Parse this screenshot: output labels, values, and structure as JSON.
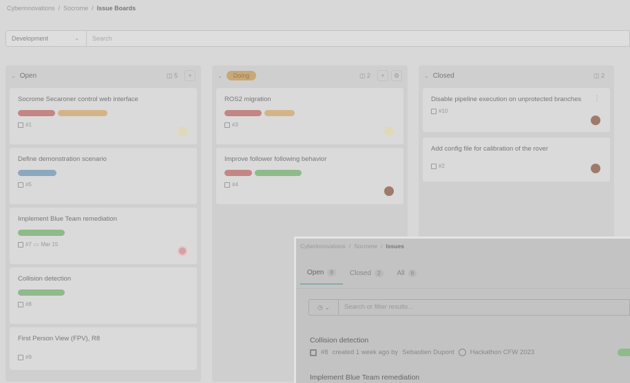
{
  "breadcrumb": [
    "Cyberinnovations",
    "Socrome",
    "Issue Boards"
  ],
  "board": {
    "selector": "Development",
    "search_placeholder": "Search"
  },
  "columns": {
    "open": {
      "title": "Open",
      "count": "5",
      "cards": [
        {
          "title": "Socrome Secaroner control web interface",
          "number": "#1",
          "labels": [
            "red",
            "orange"
          ]
        },
        {
          "title": "Define demonstration scenario",
          "number": "#5",
          "labels": [
            "blue"
          ]
        },
        {
          "title": "Implement Blue Team remediation",
          "number": "#7",
          "due": "Mar 15",
          "labels": [
            "green"
          ]
        },
        {
          "title": "Collision detection",
          "number": "#8",
          "labels": [
            "green"
          ]
        },
        {
          "title": "First Person View (FPV), R8",
          "number": "#9",
          "labels": []
        }
      ]
    },
    "doing": {
      "title": "Doing",
      "count": "2",
      "cards": [
        {
          "title": "ROS2 migration",
          "number": "#3",
          "labels": [
            "red",
            "orange"
          ]
        },
        {
          "title": "Improve follower following behavior",
          "number": "#4",
          "labels": [
            "red",
            "green"
          ]
        }
      ]
    },
    "closed": {
      "title": "Closed",
      "count": "2",
      "cards": [
        {
          "title": "Disable pipeline execution on unprotected branches",
          "number": "#10"
        },
        {
          "title": "Add config file for calibration of the rover",
          "number": "#2"
        }
      ]
    }
  },
  "overlay": {
    "breadcrumb": [
      "Cyberinnovations",
      "Socrome",
      "Issues"
    ],
    "tabs": [
      {
        "label": "Open",
        "count": "8"
      },
      {
        "label": "Closed",
        "count": "2"
      },
      {
        "label": "All",
        "count": "8"
      }
    ],
    "search_placeholder": "Search or filter results...",
    "issues": [
      {
        "title": "Collision detection",
        "number": "#8",
        "created": "created 1 week ago by",
        "author": "Sebastien Dupont",
        "milestone": "Hackathon CFW 2023"
      },
      {
        "title": "Implement Blue Team remediation"
      }
    ]
  },
  "colors": {
    "label_red": "#c48585",
    "label_orange": "#d4b487",
    "label_blue": "#8aa8c0",
    "label_green": "#8fba8a"
  }
}
